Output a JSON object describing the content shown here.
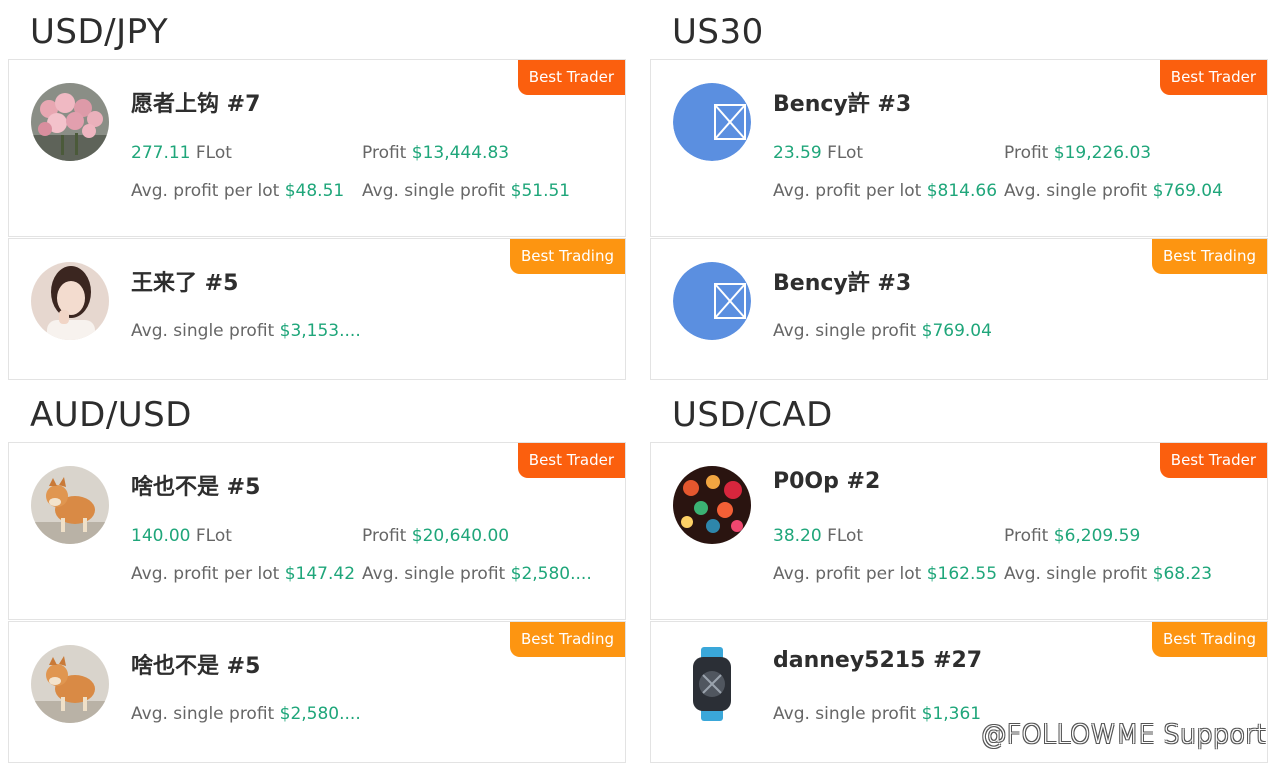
{
  "colors": {
    "best_trader": "#fb5f0e",
    "best_trading": "#fd9511",
    "value_green": "#1fa67a"
  },
  "sections": [
    {
      "title": "USD/JPY",
      "trader": {
        "badge": "Best Trader",
        "name": "愿者上钩 #7",
        "flot_value": "277.11",
        "flot_label": "FLot",
        "profit_label": "Profit",
        "profit_value": "$13,444.83",
        "avg_lot_label": "Avg. profit per lot",
        "avg_lot_value": "$48.51",
        "avg_single_label": "Avg. single profit",
        "avg_single_value": "$51.51",
        "avatar": "flowers-photo"
      },
      "trading": {
        "badge": "Best Trading",
        "name": "王来了 #5",
        "avg_single_label": "Avg. single profit",
        "avg_single_value": "$3,153....",
        "avatar": "woman-photo"
      }
    },
    {
      "title": "US30",
      "trader": {
        "badge": "Best Trader",
        "name": "Bency許 #3",
        "flot_value": "23.59",
        "flot_label": "FLot",
        "profit_label": "Profit",
        "profit_value": "$19,226.03",
        "avg_lot_label": "Avg. profit per lot",
        "avg_lot_value": "$814.66",
        "avg_single_label": "Avg. single profit",
        "avg_single_value": "$769.04",
        "avatar": "placeholder-image-icon"
      },
      "trading": {
        "badge": "Best Trading",
        "name": "Bency許 #3",
        "avg_single_label": "Avg. single profit",
        "avg_single_value": "$769.04",
        "avatar": "placeholder-image-icon"
      }
    },
    {
      "title": "AUD/USD",
      "trader": {
        "badge": "Best Trader",
        "name": "啥也不是 #5",
        "flot_value": "140.00",
        "flot_label": "FLot",
        "profit_label": "Profit",
        "profit_value": "$20,640.00",
        "avg_lot_label": "Avg. profit per lot",
        "avg_lot_value": "$147.42",
        "avg_single_label": "Avg. single profit",
        "avg_single_value": "$2,580....",
        "avatar": "dog-photo"
      },
      "trading": {
        "badge": "Best Trading",
        "name": "啥也不是 #5",
        "avg_single_label": "Avg. single profit",
        "avg_single_value": "$2,580....",
        "avatar": "dog-photo"
      }
    },
    {
      "title": "USD/CAD",
      "trader": {
        "badge": "Best Trader",
        "name": "P0Op #2",
        "flot_value": "38.20",
        "flot_label": "FLot",
        "profit_label": "Profit",
        "profit_value": "$6,209.59",
        "avg_lot_label": "Avg. profit per lot",
        "avg_lot_value": "$162.55",
        "avg_single_label": "Avg. single profit",
        "avg_single_value": "$68.23",
        "avatar": "lanterns-photo"
      },
      "trading": {
        "badge": "Best Trading",
        "name": "danney5215 #27",
        "avg_single_label": "Avg. single profit",
        "avg_single_value": "$1,361",
        "avatar": "watch-photo"
      }
    }
  ],
  "watermark": "@FOLLOWME Support"
}
